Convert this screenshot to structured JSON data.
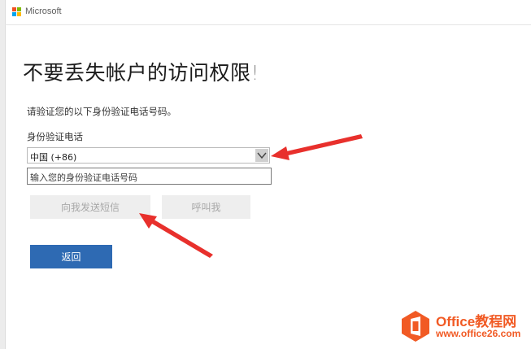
{
  "header": {
    "brand": "Microsoft",
    "logo_colors": [
      "#f25022",
      "#7fba00",
      "#00a4ef",
      "#ffb900"
    ]
  },
  "main": {
    "title": "不要丢失帐户的访问权限",
    "title_suffix": "!",
    "prompt": "请验证您的以下身份验证电话号码。",
    "phone_label": "身份验证电话",
    "country_select": {
      "value": "中国 (+86)"
    },
    "phone_input": {
      "value": "",
      "placeholder": "输入您的身份验证电话号码"
    },
    "buttons": {
      "send_sms": "向我发送短信",
      "call_me": "呼叫我",
      "back": "返回"
    }
  },
  "colors": {
    "primary_button": "#2e6ab3",
    "annotation_arrow": "#e8302c",
    "watermark": "#f15a24"
  },
  "watermark": {
    "brand": "Office教程网",
    "url": "www.office26.com"
  }
}
